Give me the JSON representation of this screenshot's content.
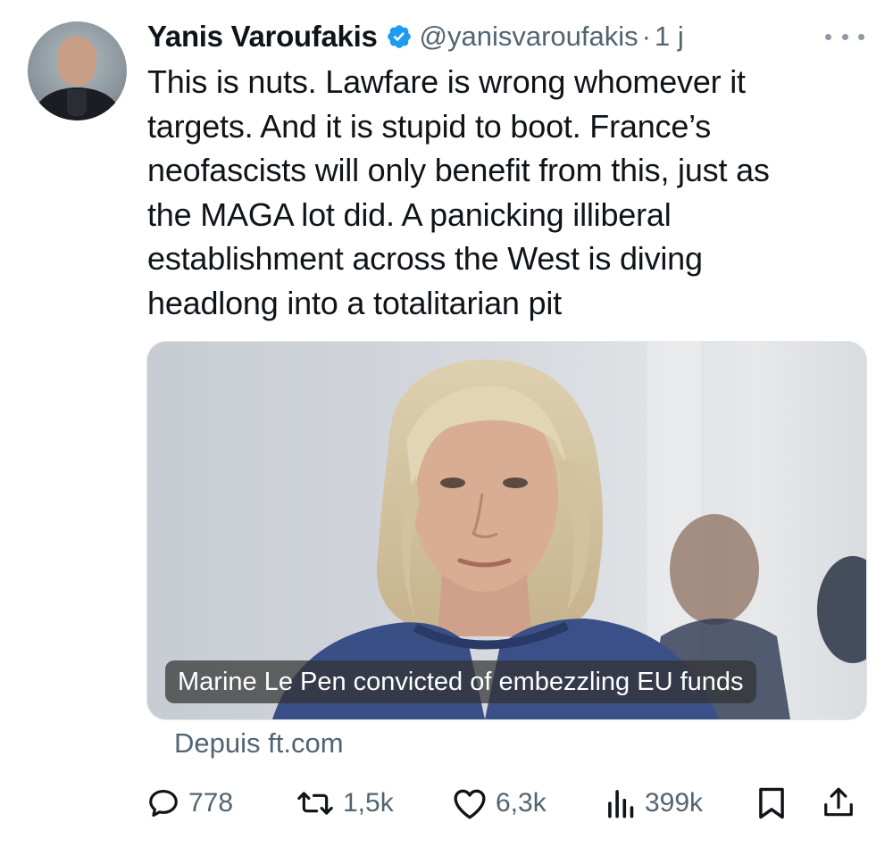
{
  "tweet": {
    "author_name": "Yanis Varoufakis",
    "handle": "@yanisvaroufakis",
    "separator": "·",
    "time": "1 j",
    "verified_color": "#1d9bf0",
    "text_lines": [
      "This is nuts. Lawfare is wrong whomever it",
      "targets. And it is stupid to boot. France’s",
      "neofascists will only benefit from this, just as",
      "the MAGA lot did. A panicking illiberal",
      "establishment across the West is diving",
      "headlong into a totalitarian pit"
    ]
  },
  "card": {
    "caption": "Marine Le Pen convicted of embezzling EU funds",
    "source": "Depuis ft.com"
  },
  "actions": {
    "replies": "778",
    "reposts": "1,5k",
    "likes": "6,3k",
    "views": "399k"
  },
  "icons": {
    "verified": "verified-badge-icon",
    "more": "more-dots-icon",
    "reply": "reply-bubble-icon",
    "repost": "repost-arrows-icon",
    "like": "heart-icon",
    "views": "bar-chart-icon",
    "bookmark": "bookmark-icon",
    "share": "share-upload-icon"
  }
}
